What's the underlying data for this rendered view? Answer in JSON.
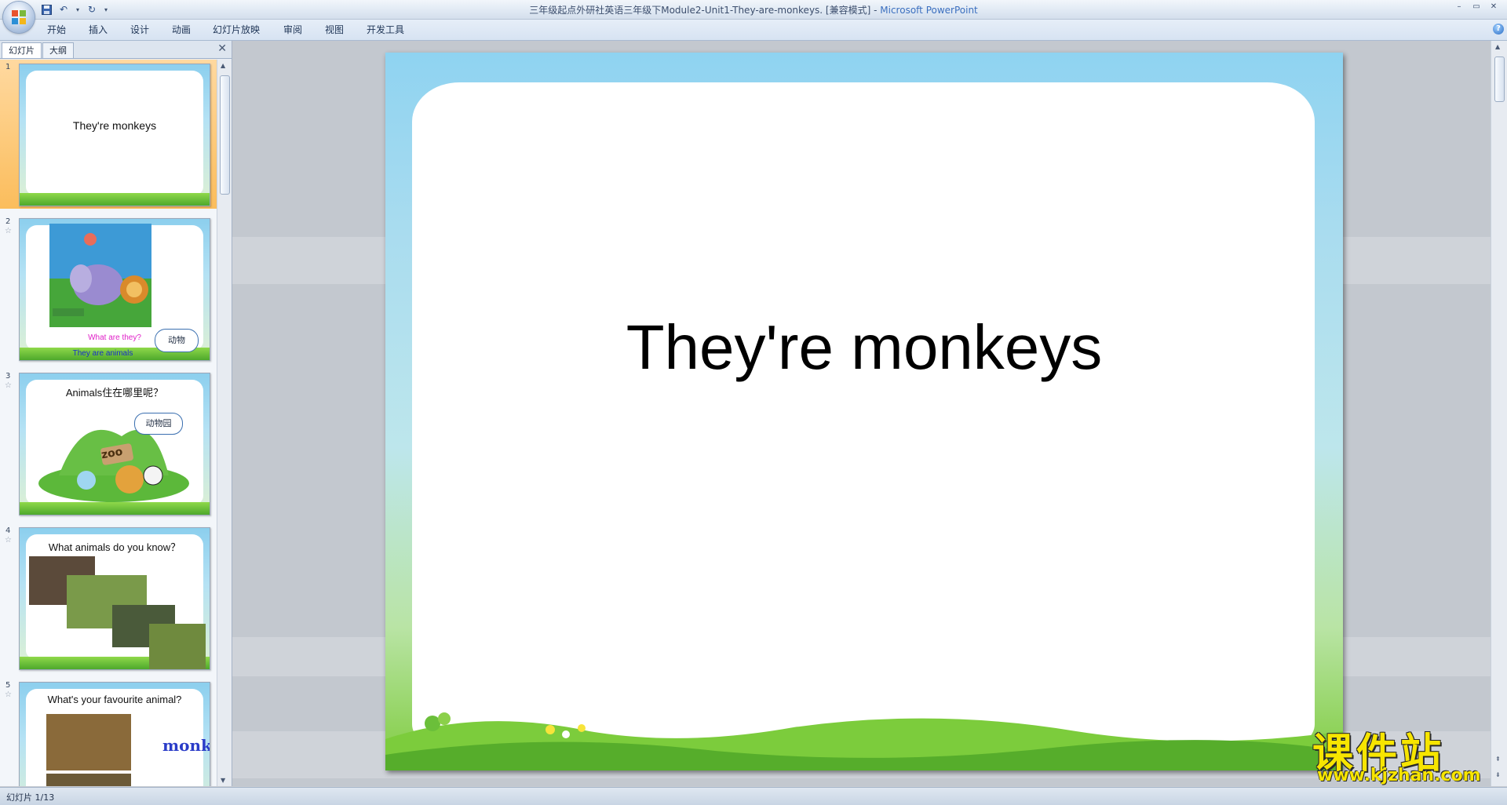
{
  "window": {
    "title": "三年级起点外研社英语三年级下Module2-Unit1-They-are-monkeys. [兼容模式]",
    "separator": " - ",
    "app_name": "Microsoft PowerPoint",
    "controls": [
      "–",
      "▭",
      "✕"
    ]
  },
  "quick_access": {
    "icons": [
      "save-icon",
      "undo-icon",
      "redo-icon"
    ]
  },
  "ribbon": {
    "tabs": [
      "开始",
      "插入",
      "设计",
      "动画",
      "幻灯片放映",
      "审阅",
      "视图",
      "开发工具"
    ]
  },
  "left_panel": {
    "tabs": [
      "幻灯片",
      "大纲"
    ],
    "close": "✕"
  },
  "thumbnails": [
    {
      "num": "1",
      "title": "They're monkeys"
    },
    {
      "num": "2",
      "line1": "What are they?",
      "line2": "They are animals",
      "bubble": "动物"
    },
    {
      "num": "3",
      "title": "Animals住在哪里呢？",
      "bubble": "动物园",
      "sign": "zoo"
    },
    {
      "num": "4",
      "title": "What animals do you know？"
    },
    {
      "num": "5",
      "title": "What's your favourite animal?",
      "word": "monkey"
    }
  ],
  "slide": {
    "title": "They're monkeys"
  },
  "status": {
    "slide_indicator": "幻灯片 1/13"
  },
  "watermark": {
    "main": "课件站",
    "url": "www.kjzhan.com"
  },
  "colors": {
    "selected_thumb": "#fbbd5c",
    "slide_sky": "#8fd3f1",
    "slide_grass": "#7fcc3e",
    "watermark": "#f7e500"
  }
}
